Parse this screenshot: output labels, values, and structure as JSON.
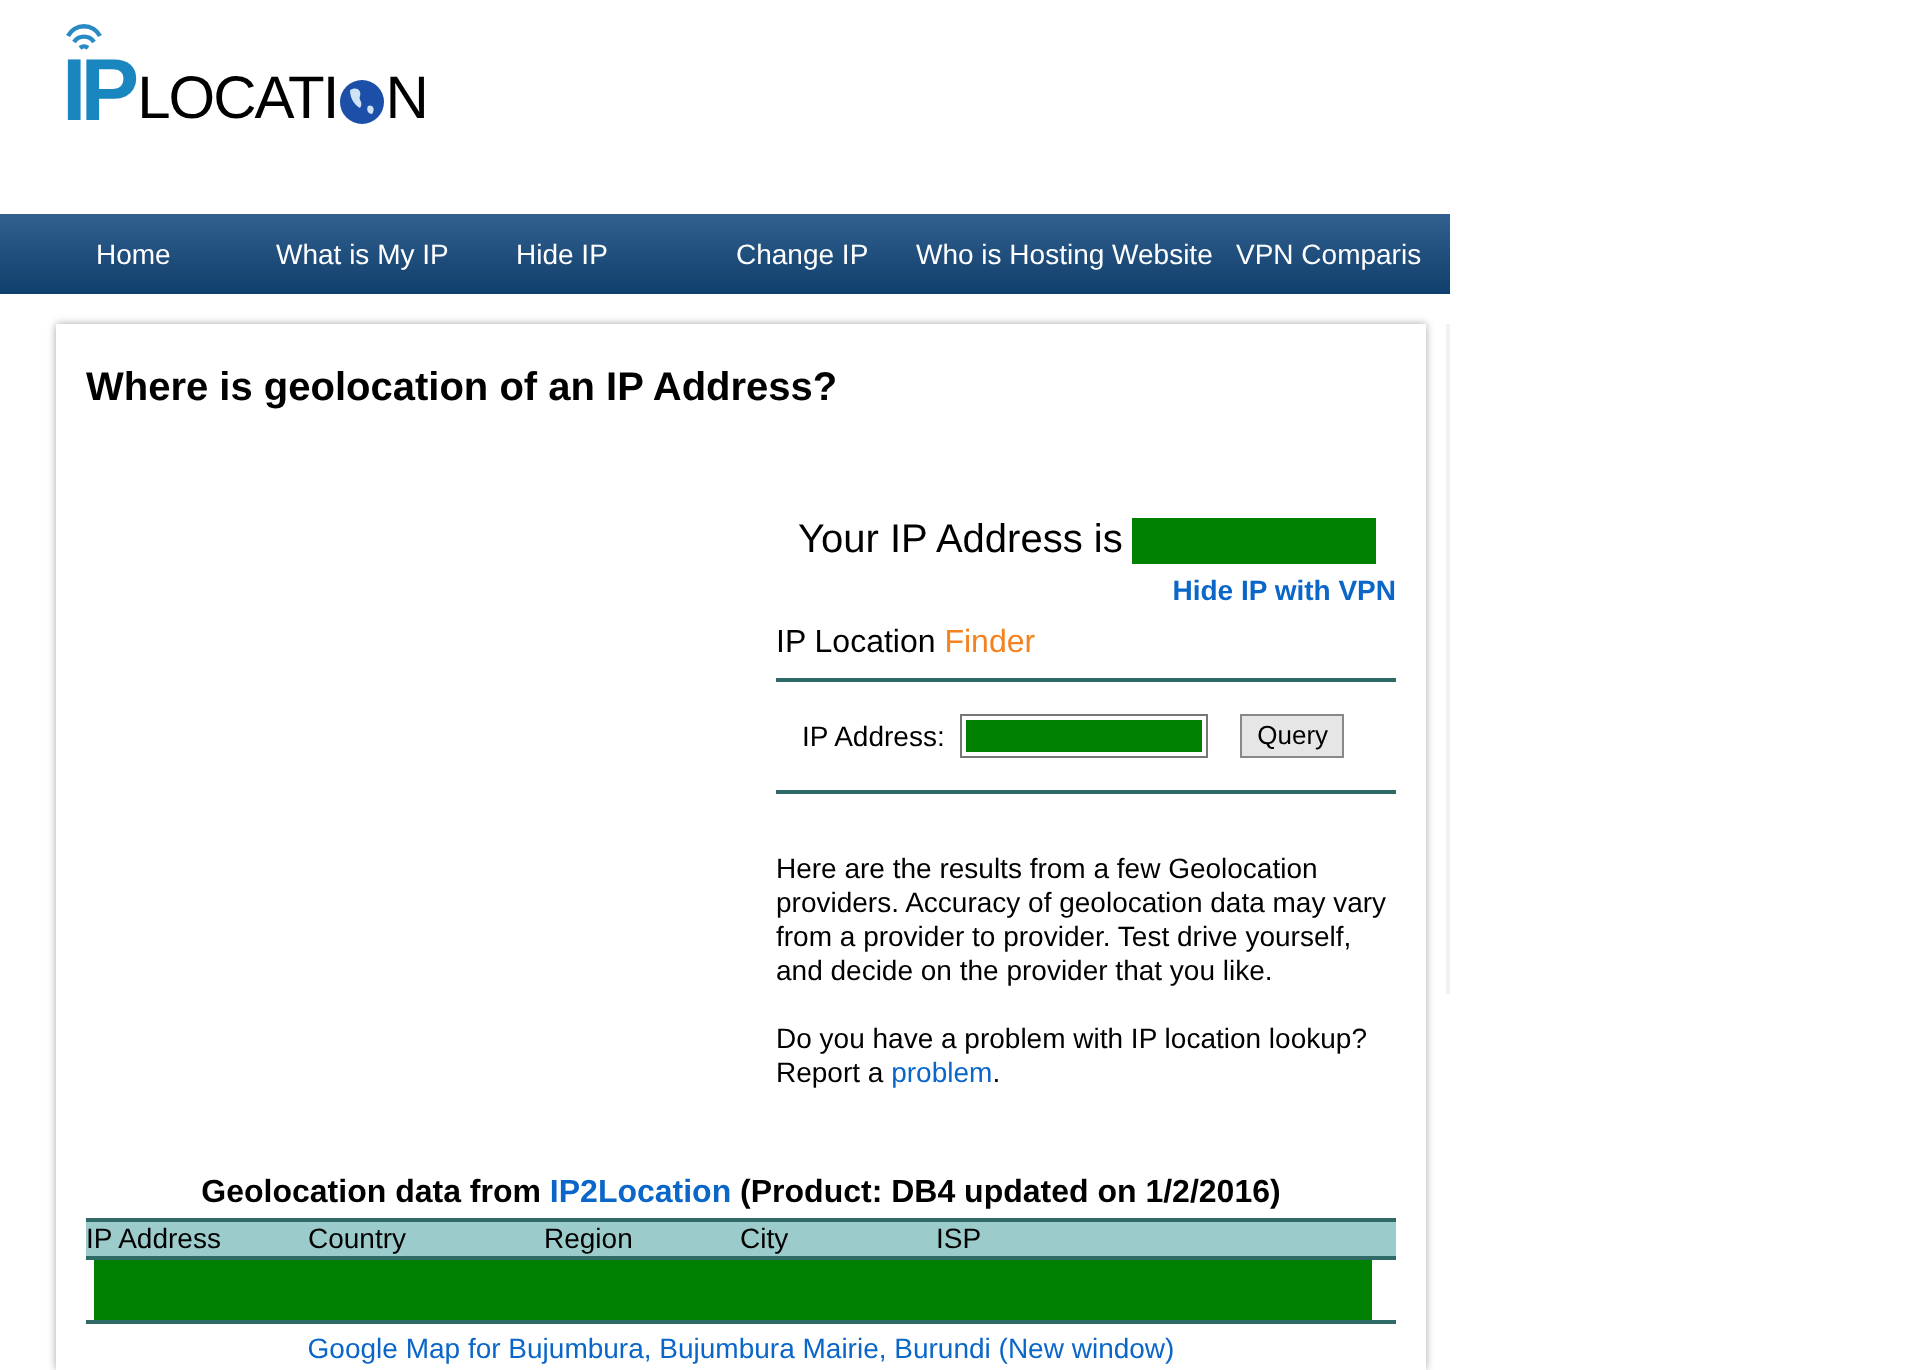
{
  "logo": {
    "mark": "IP",
    "word_start": "LOCATI",
    "word_end": "N"
  },
  "nav": [
    {
      "label": "Home"
    },
    {
      "label": "What is My IP"
    },
    {
      "label": "Hide IP"
    },
    {
      "label": "Change IP"
    },
    {
      "label": "Who is Hosting Website"
    },
    {
      "label": "VPN Comparis"
    }
  ],
  "page_title": "Where is geolocation of an IP Address?",
  "your_ip": {
    "label": "Your IP Address is",
    "link": "Hide IP with VPN"
  },
  "finder": {
    "title": "IP Location",
    "title_accent": "Finder",
    "field_label": "IP Address:",
    "button": "Query"
  },
  "intro": "Here are the results from a few Geolocation providers. Accuracy of geolocation data may vary from a provider to provider. Test drive yourself, and decide on the provider that you like.",
  "problem": {
    "text": "Do you have a problem with IP location lookup? Report a",
    "link": "problem",
    "end": "."
  },
  "results": {
    "heading_start": "Geolocation data from",
    "provider": "IP2Location",
    "heading_end": "(Product: DB4 updated on 1/2/2016)",
    "columns": [
      "IP Address",
      "Country",
      "Region",
      "City",
      "ISP"
    ],
    "map_link": "Google Map for Bujumbura, Bujumbura Mairie, Burundi (New window)"
  }
}
